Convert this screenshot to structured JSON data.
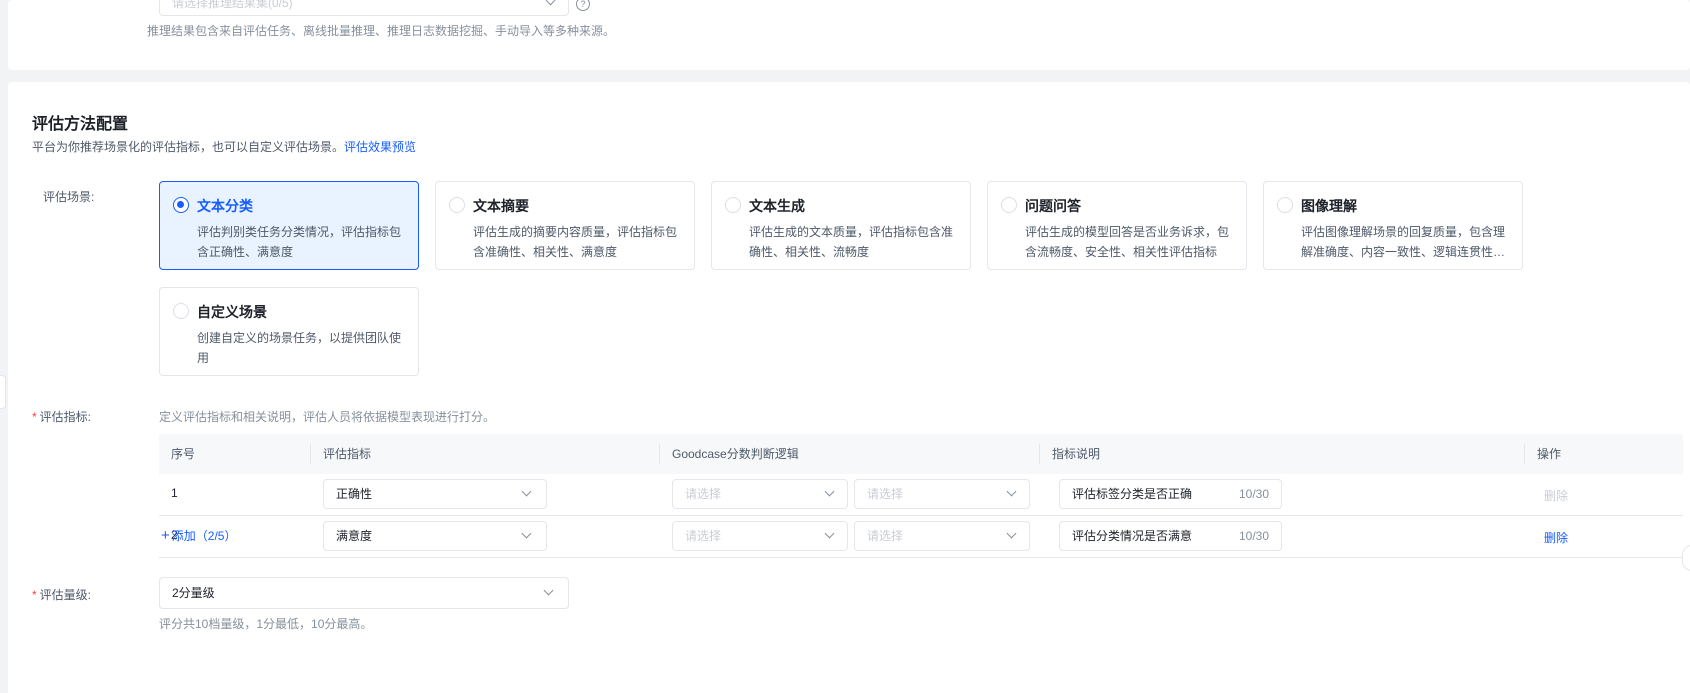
{
  "inference": {
    "placeholder": "请选择推理结果集(0/5)",
    "help": "?",
    "hint": "推理结果包含来自评估任务、离线批量推理、推理日志数据挖掘、手动导入等多种来源。"
  },
  "method": {
    "title": "评估方法配置",
    "desc": "平台为你推荐场景化的评估指标，也可以自定义评估场景。",
    "preview_link": "评估效果预览"
  },
  "scene": {
    "label": "评估场景:",
    "options": [
      {
        "title": "文本分类",
        "desc": "评估判别类任务分类情况，评估指标包含正确性、满意度",
        "selected": true
      },
      {
        "title": "文本摘要",
        "desc": "评估生成的摘要内容质量，评估指标包含准确性、相关性、满意度",
        "selected": false
      },
      {
        "title": "文本生成",
        "desc": "评估生成的文本质量，评估指标包含准确性、相关性、流畅度",
        "selected": false
      },
      {
        "title": "问题问答",
        "desc": "评估生成的模型回答是否业务诉求，包含流畅度、安全性、相关性评估指标",
        "selected": false
      },
      {
        "title": "图像理解",
        "desc": "评估图像理解场景的回复质量，包含理解准确度、内容一致性、逻辑连贯性、图文相关性等评估指标",
        "selected": false
      },
      {
        "title": "自定义场景",
        "desc": "创建自定义的场景任务，以提供团队使用",
        "selected": false
      }
    ]
  },
  "metrics": {
    "required": "*",
    "label": "评估指标:",
    "hint": "定义评估指标和相关说明，评估人员将依据模型表现进行打分。",
    "columns": [
      "序号",
      "评估指标",
      "Goodcase分数判断逻辑",
      "指标说明",
      "操作"
    ],
    "rows": [
      {
        "index": "1",
        "metric": "正确性",
        "logic_a": "请选择",
        "logic_b": "请选择",
        "desc": "评估标签分类是否正确",
        "count": "10/30",
        "op": "删除",
        "op_enabled": false
      },
      {
        "index": "2",
        "metric": "满意度",
        "logic_a": "请选择",
        "logic_b": "请选择",
        "desc": "评估分类情况是否满意",
        "count": "10/30",
        "op": "删除",
        "op_enabled": true
      }
    ],
    "add_icon": "+",
    "add_label": "添加（2/5）"
  },
  "level": {
    "required": "*",
    "label": "评估量级:",
    "value": "2分量级",
    "hint": "评分共10档量级，1分最低，10分最高。"
  },
  "colors": {
    "primary": "#165dff",
    "danger": "#f53f3f",
    "muted": "#86909c"
  }
}
